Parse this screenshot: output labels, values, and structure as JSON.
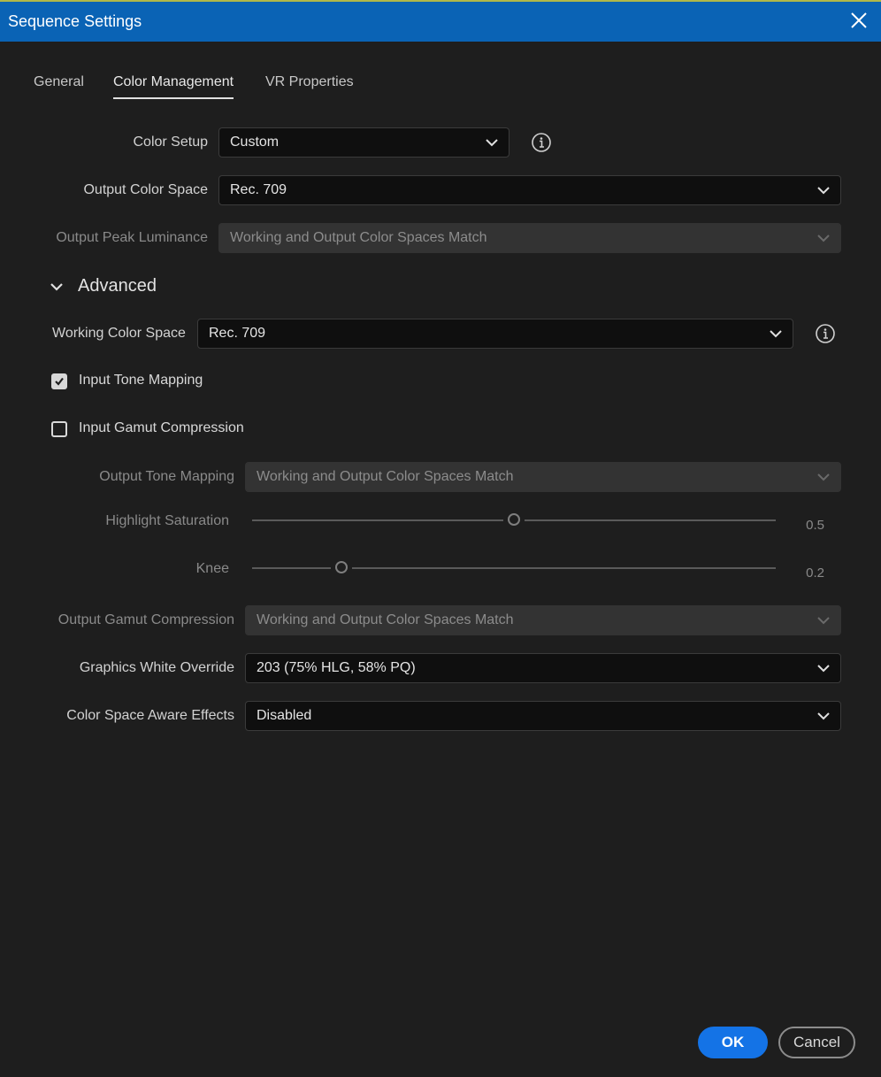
{
  "window": {
    "title": "Sequence Settings"
  },
  "tabs": [
    {
      "label": "General",
      "active": false
    },
    {
      "label": "Color Management",
      "active": true
    },
    {
      "label": "VR Properties",
      "active": false
    }
  ],
  "fields": {
    "color_setup": {
      "label": "Color Setup",
      "value": "Custom"
    },
    "output_color_space": {
      "label": "Output Color Space",
      "value": "Rec. 709"
    },
    "output_peak_luminance": {
      "label": "Output Peak Luminance",
      "value": "Working and Output Color Spaces Match",
      "disabled": true
    }
  },
  "advanced": {
    "label": "Advanced",
    "expanded": true,
    "working_color_space": {
      "label": "Working Color Space",
      "value": "Rec. 709"
    },
    "input_tone_mapping": {
      "label": "Input Tone Mapping",
      "checked": true
    },
    "input_gamut_compression": {
      "label": "Input Gamut Compression",
      "checked": false
    },
    "output_tone_mapping": {
      "label": "Output Tone Mapping",
      "value": "Working and Output Color Spaces Match",
      "disabled": true
    },
    "highlight_saturation": {
      "label": "Highlight Saturation",
      "value": "0.5",
      "level": 0.5
    },
    "knee": {
      "label": "Knee",
      "value": "0.2",
      "level": 0.17
    },
    "output_gamut_compression": {
      "label": "Output Gamut Compression",
      "value": "Working and Output Color Spaces Match",
      "disabled": true
    },
    "graphics_white_override": {
      "label": "Graphics White Override",
      "value": "203 (75% HLG, 58% PQ)"
    },
    "color_space_aware_effects": {
      "label": "Color Space Aware Effects",
      "value": "Disabled"
    }
  },
  "buttons": {
    "ok": "OK",
    "cancel": "Cancel"
  },
  "colors": {
    "accent": "#1473e6",
    "titlebar": "#0a63b5",
    "background": "#1e1e1e"
  }
}
